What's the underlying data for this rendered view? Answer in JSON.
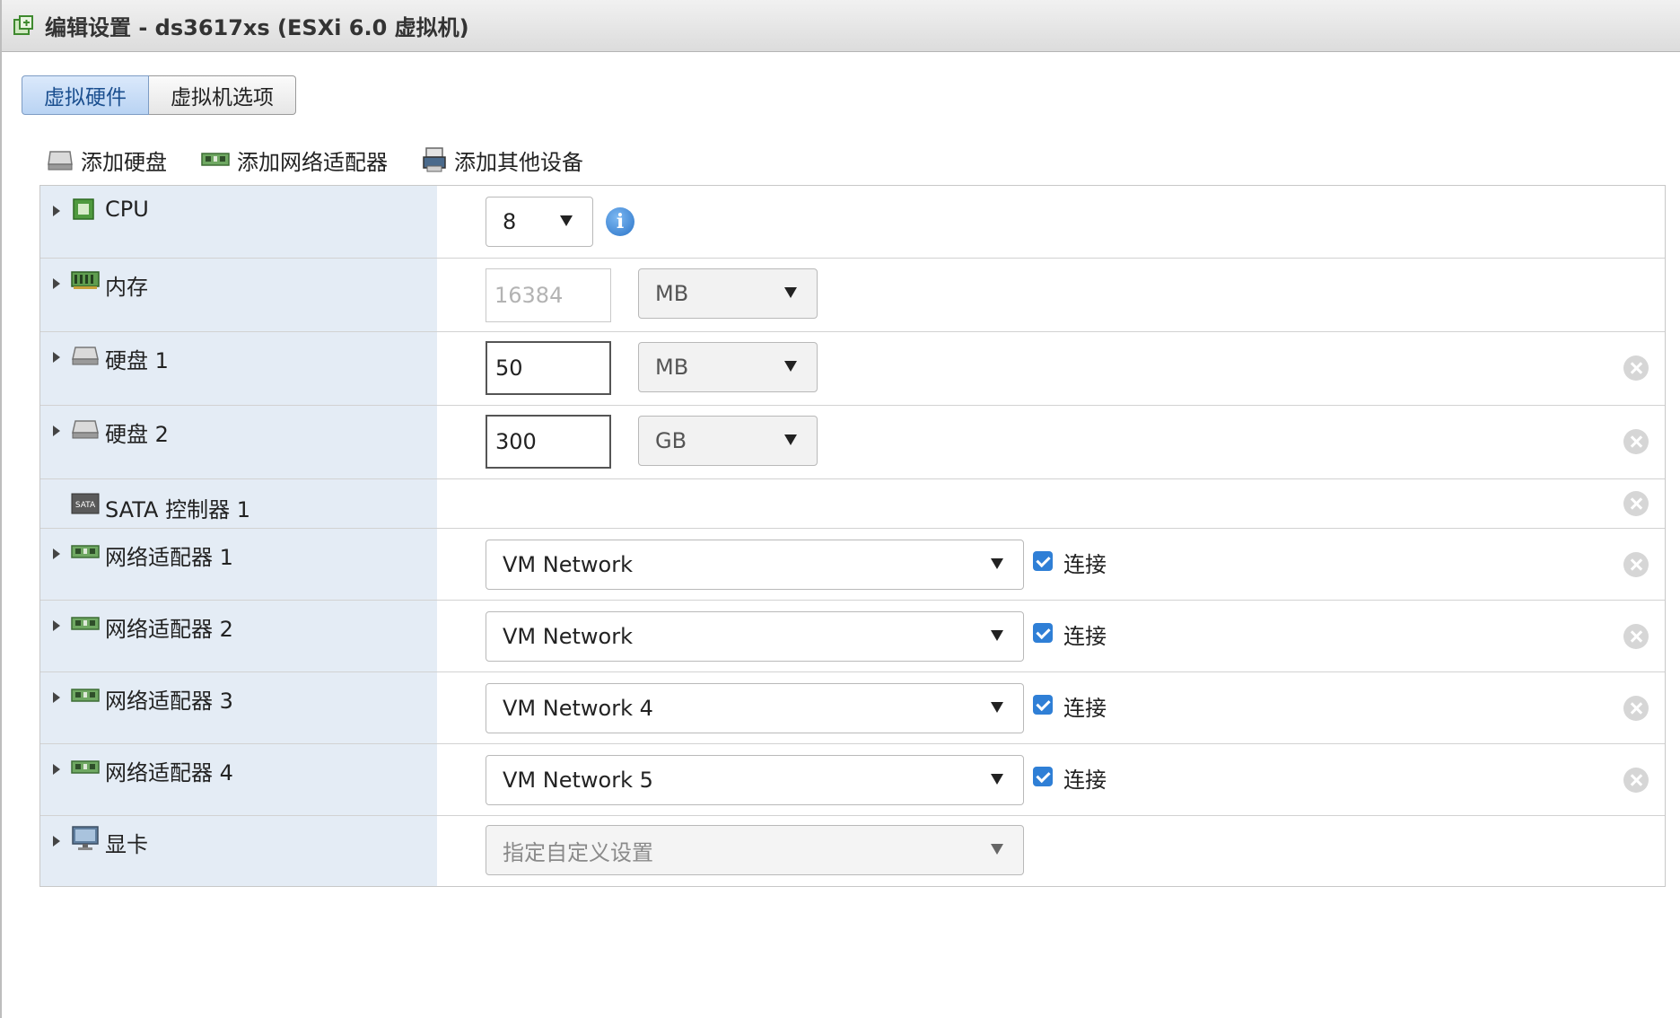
{
  "window": {
    "title": "编辑设置 - ds3617xs (ESXi 6.0 虚拟机)"
  },
  "tabs": [
    {
      "label": "虚拟硬件",
      "active": true
    },
    {
      "label": "虚拟机选项",
      "active": false
    }
  ],
  "toolbar": {
    "add_disk": "添加硬盘",
    "add_nic": "添加网络适配器",
    "add_other": "添加其他设备"
  },
  "hardware": {
    "cpu": {
      "label": "CPU",
      "value": "8"
    },
    "memory": {
      "label": "内存",
      "value": "16384",
      "unit": "MB"
    },
    "disk1": {
      "label": "硬盘 1",
      "value": "50",
      "unit": "MB"
    },
    "disk2": {
      "label": "硬盘 2",
      "value": "300",
      "unit": "GB"
    },
    "sata": {
      "label": "SATA 控制器 1",
      "icon_text": "SATA"
    },
    "nic1": {
      "label": "网络适配器 1",
      "network": "VM Network",
      "connect_label": "连接",
      "connected": true
    },
    "nic2": {
      "label": "网络适配器 2",
      "network": "VM Network",
      "connect_label": "连接",
      "connected": true
    },
    "nic3": {
      "label": "网络适配器 3",
      "network": "VM Network 4",
      "connect_label": "连接",
      "connected": true
    },
    "nic4": {
      "label": "网络适配器 4",
      "network": "VM Network 5",
      "connect_label": "连接",
      "connected": true
    },
    "video": {
      "label": "显卡",
      "value": "指定自定义设置"
    }
  },
  "colors": {
    "accent": "#2f7fd6",
    "label_bg": "#e4ecf5",
    "tab_active": "#b9d3f3"
  },
  "icons": [
    "vm-edit-icon",
    "hard-disk-icon",
    "network-card-icon",
    "other-device-icon",
    "cpu-icon",
    "memory-icon",
    "sata-icon",
    "monitor-icon",
    "info-icon",
    "remove-icon"
  ]
}
